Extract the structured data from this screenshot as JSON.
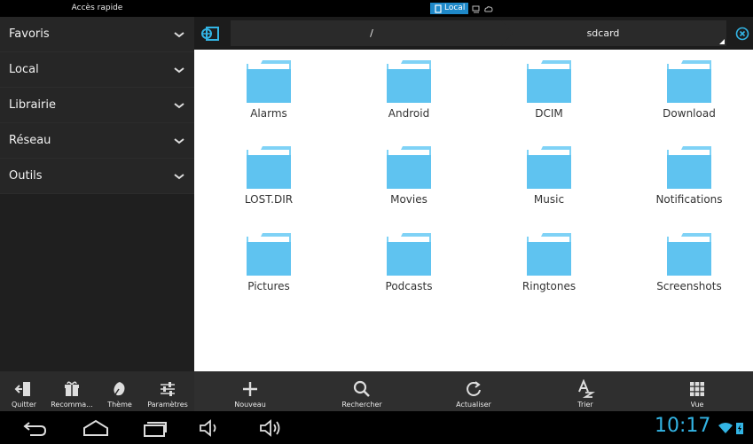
{
  "topbar": {
    "quick_access_title": "Accès rapide",
    "sources": [
      {
        "label": "Local",
        "icon": "phone-icon",
        "active": true
      },
      {
        "label": "",
        "icon": "network-icon",
        "active": false
      },
      {
        "label": "",
        "icon": "cloud-icon",
        "active": false
      }
    ]
  },
  "sidebar": {
    "items": [
      {
        "label": "Favoris"
      },
      {
        "label": "Local"
      },
      {
        "label": "Librairie"
      },
      {
        "label": "Réseau"
      },
      {
        "label": "Outils"
      }
    ]
  },
  "pathbar": {
    "segments": [
      "/",
      "sdcard"
    ]
  },
  "files": [
    {
      "name": "Alarms"
    },
    {
      "name": "Android"
    },
    {
      "name": "DCIM"
    },
    {
      "name": "Download"
    },
    {
      "name": "LOST.DIR"
    },
    {
      "name": "Movies"
    },
    {
      "name": "Music"
    },
    {
      "name": "Notifications"
    },
    {
      "name": "Pictures"
    },
    {
      "name": "Podcasts"
    },
    {
      "name": "Ringtones"
    },
    {
      "name": "Screenshots"
    }
  ],
  "side_tools": [
    {
      "label": "Quitter",
      "icon": "exit-icon"
    },
    {
      "label": "Recomma...",
      "icon": "gift-icon"
    },
    {
      "label": "Thème",
      "icon": "theme-icon"
    },
    {
      "label": "Paramètres",
      "icon": "settings-sliders-icon"
    }
  ],
  "main_tools": [
    {
      "label": "Nouveau",
      "icon": "plus-icon"
    },
    {
      "label": "Rechercher",
      "icon": "search-icon"
    },
    {
      "label": "Actualiser",
      "icon": "refresh-icon"
    },
    {
      "label": "Trier",
      "icon": "sort-icon"
    },
    {
      "label": "Vue",
      "icon": "grid-view-icon"
    }
  ],
  "status": {
    "clock": "10:17"
  },
  "colors": {
    "accent": "#33b5e5",
    "folder": "#5fc3f0",
    "folder_tab": "#7fd2f6"
  }
}
